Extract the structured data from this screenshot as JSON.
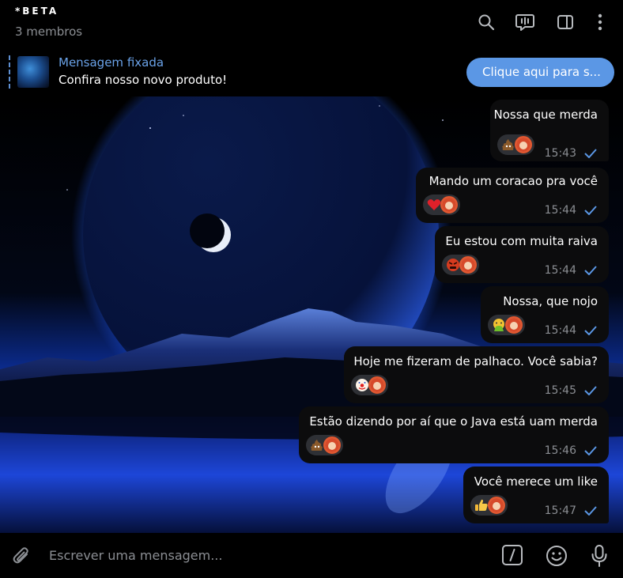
{
  "header": {
    "title": "*BETA",
    "subtitle": "3 membros",
    "icons": [
      "search-icon",
      "voice-chat-icon",
      "sidebar-toggle-icon",
      "more-vertical-icon"
    ]
  },
  "pinned": {
    "title": "Mensagem fixada",
    "text": "Confira nosso novo produto!",
    "button_label": "Clique aqui para s..."
  },
  "messages": [
    {
      "text": "Nossa que merda",
      "reaction": "poop",
      "time": "15:43",
      "status": "sent"
    },
    {
      "text": "Mando um coracao pra você",
      "reaction": "red-heart",
      "time": "15:44",
      "status": "sent"
    },
    {
      "text": "Eu estou com muita raiva",
      "reaction": "angry-face",
      "time": "15:44",
      "status": "sent"
    },
    {
      "text": "Nossa, que nojo",
      "reaction": "vomiting-face",
      "time": "15:44",
      "status": "sent"
    },
    {
      "text": "Hoje me fizeram de palhaco. Você sabia?",
      "reaction": "clown-face",
      "time": "15:45",
      "status": "sent"
    },
    {
      "text": "Estão dizendo por aí que o Java está uam merda",
      "reaction": "poop",
      "time": "15:46",
      "status": "sent"
    },
    {
      "text": "Você merece um like",
      "reaction": "thumbs-up",
      "time": "15:47",
      "status": "sent"
    }
  ],
  "composer": {
    "placeholder": "Escrever uma mensagem...",
    "icons": [
      "paperclip-icon",
      "bot-command-icon",
      "emoji-icon",
      "microphone-icon"
    ]
  },
  "colors": {
    "accent": "#5b97e5",
    "link": "#6aa2e8",
    "bubble": "#0c0c0d",
    "muted": "#8b8e93",
    "check": "#5b97e5"
  }
}
